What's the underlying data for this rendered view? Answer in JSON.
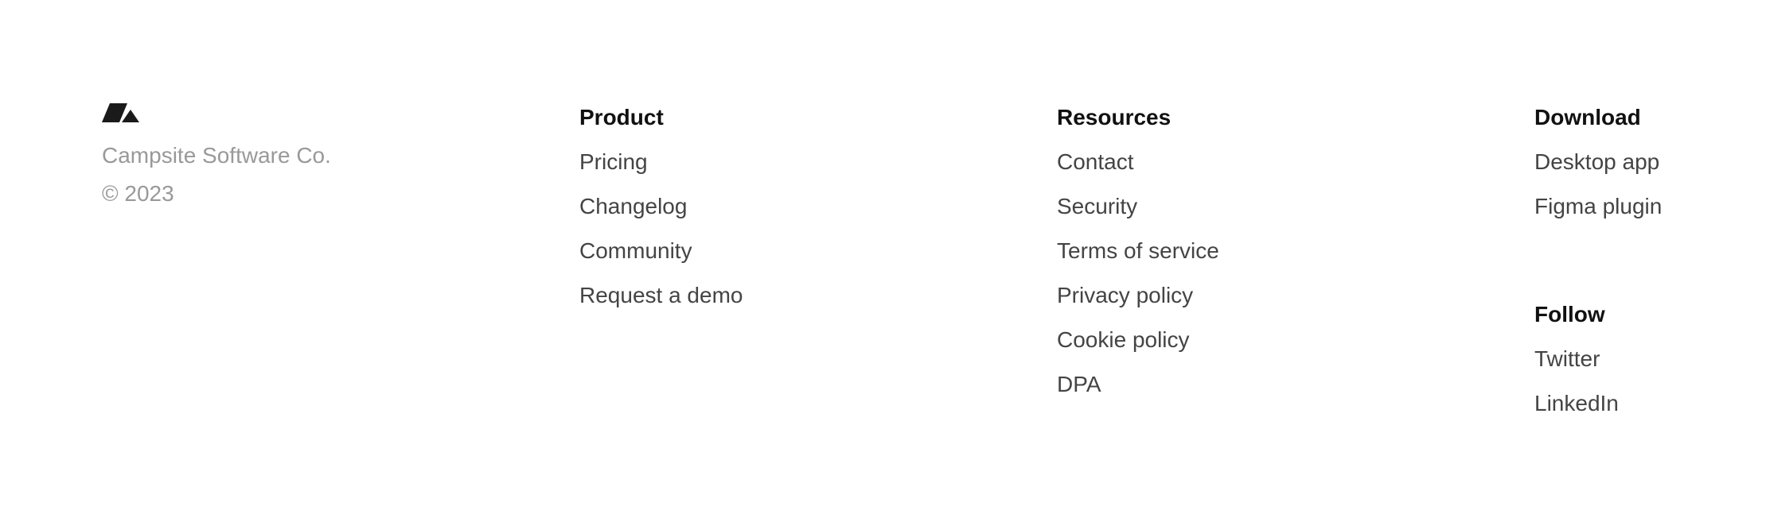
{
  "brand": {
    "logo_icon": "campsite-logo-icon",
    "company": "Campsite Software Co.",
    "copyright": "© 2023"
  },
  "columns": {
    "product": {
      "title": "Product",
      "links": [
        "Pricing",
        "Changelog",
        "Community",
        "Request a demo"
      ]
    },
    "resources": {
      "title": "Resources",
      "links": [
        "Contact",
        "Security",
        "Terms of service",
        "Privacy policy",
        "Cookie policy",
        "DPA"
      ]
    },
    "download": {
      "title": "Download",
      "links": [
        "Desktop app",
        "Figma plugin"
      ]
    },
    "follow": {
      "title": "Follow",
      "links": [
        "Twitter",
        "LinkedIn"
      ]
    }
  },
  "colors": {
    "heading": "#111111",
    "link": "#444444",
    "muted": "#999999",
    "background": "#ffffff"
  }
}
